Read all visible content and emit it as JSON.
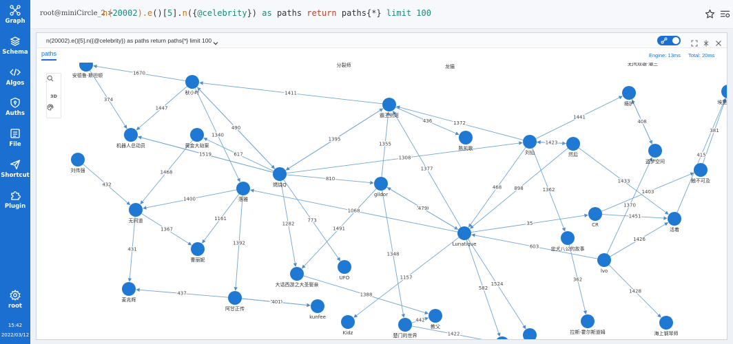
{
  "sidebar": {
    "items": [
      {
        "label": "Graph",
        "icon": "graph-icon"
      },
      {
        "label": "Schema",
        "icon": "layers-icon"
      },
      {
        "label": "Algos",
        "icon": "code-icon"
      },
      {
        "label": "Auths",
        "icon": "shield-icon"
      },
      {
        "label": "File",
        "icon": "file-icon"
      },
      {
        "label": "Shortcut",
        "icon": "send-icon"
      },
      {
        "label": "Plugin",
        "icon": "puzzle-icon"
      }
    ],
    "user": "root",
    "time": "15:42",
    "date": "2022/03/12"
  },
  "command": {
    "prompt": "root@miniCircle_2 >",
    "query_parts": [
      {
        "t": "n(",
        "c": "q-fn"
      },
      {
        "t": "20002",
        "c": "q-num"
      },
      {
        "t": ").",
        "c": "q-fn"
      },
      {
        "t": "e",
        "c": "q-fn"
      },
      {
        "t": "()[",
        "c": "q-txt"
      },
      {
        "t": "5",
        "c": "q-num"
      },
      {
        "t": "].",
        "c": "q-txt"
      },
      {
        "t": "n",
        "c": "q-fn"
      },
      {
        "t": "({",
        "c": "q-txt"
      },
      {
        "t": "@celebrity",
        "c": "q-num"
      },
      {
        "t": "}) ",
        "c": "q-txt"
      },
      {
        "t": "as",
        "c": "q-num"
      },
      {
        "t": " paths ",
        "c": "q-txt"
      },
      {
        "t": "return",
        "c": "q-kw"
      },
      {
        "t": " paths",
        "c": "q-txt"
      },
      {
        "t": "{*} ",
        "c": "q-txt"
      },
      {
        "t": "limit",
        "c": "q-num"
      },
      {
        "t": " 100",
        "c": "q-num"
      }
    ]
  },
  "panel": {
    "title": "n(20002).e()[5].n({@celebrity}) as paths return paths{*} limit 100",
    "tab": "paths",
    "engine": "Engine: 13ms",
    "total": "Total: 20ms"
  },
  "toolbox": {
    "search": "search-icon",
    "mode_3d": "3D",
    "style": "palette-icon"
  },
  "graph": {
    "node_color": "#1f78d1",
    "edge_color": "#6fa4d8",
    "nodes": [
      {
        "id": "n1",
        "label": "安德鲁·斯坦顿"
      },
      {
        "id": "n2",
        "label": "秋小叶"
      },
      {
        "id": "n3",
        "label": "机器人总动员"
      },
      {
        "id": "n4",
        "label": "黄金大劫案"
      },
      {
        "id": "n5",
        "label": "刘伟强"
      },
      {
        "id": "n6",
        "label": "燃烧Q"
      },
      {
        "id": "n7",
        "label": "落雅"
      },
      {
        "id": "n8",
        "label": "无间道"
      },
      {
        "id": "n9",
        "label": "霸王别姬"
      },
      {
        "id": "n10",
        "label": "陈凯歌"
      },
      {
        "id": "n11",
        "label": "gildor"
      },
      {
        "id": "n12",
        "label": "刘仙"
      },
      {
        "id": "n13",
        "label": "然后"
      },
      {
        "id": "n14",
        "label": "瘾护"
      },
      {
        "id": "n15",
        "label": "盗梦空间"
      },
      {
        "id": "n16",
        "label": "触不可及"
      },
      {
        "id": "n17",
        "label": "Lunatique"
      },
      {
        "id": "n18",
        "label": "CR"
      },
      {
        "id": "n19",
        "label": "活着"
      },
      {
        "id": "n20",
        "label": "忠犬八公的故事"
      },
      {
        "id": "n21",
        "label": "lvo"
      },
      {
        "id": "n22",
        "label": "曹丽妮"
      },
      {
        "id": "n23",
        "label": "麦兆辉"
      },
      {
        "id": "n24",
        "label": "大话西游之大圣娶亲"
      },
      {
        "id": "n25",
        "label": "UFO"
      },
      {
        "id": "n26",
        "label": "阿甘正传"
      },
      {
        "id": "n27",
        "label": "kunfee"
      },
      {
        "id": "n28",
        "label": "Kidz"
      },
      {
        "id": "n29",
        "label": "楚门的世界"
      },
      {
        "id": "n30",
        "label": "教父"
      },
      {
        "id": "n31",
        "label": "拉斯·霍尔斯道姆"
      },
      {
        "id": "n32",
        "label": "海上钢琴师"
      },
      {
        "id": "n33",
        "label": "埃里克·"
      },
      {
        "id": "n34",
        "label": ""
      },
      {
        "id": "n35",
        "label": ""
      }
    ],
    "partial_labels": [
      "分裂师",
      "龙猫",
      "无间双雄·潮三"
    ],
    "edges": [
      {
        "from": "n1",
        "to": "n3",
        "label": "374"
      },
      {
        "from": "n2",
        "to": "n3",
        "label": "1447"
      },
      {
        "from": "n2",
        "to": "n7",
        "label": "1340"
      },
      {
        "from": "n6",
        "to": "n3",
        "label": "1439"
      },
      {
        "from": "n6",
        "to": "n4",
        "label": "617"
      },
      {
        "from": "n6",
        "to": "n2",
        "label": "639"
      },
      {
        "from": "n6",
        "to": "n9",
        "label": "1382"
      },
      {
        "from": "n6",
        "to": "n11",
        "label": "810"
      },
      {
        "from": "n5",
        "to": "n8",
        "label": "432"
      },
      {
        "from": "n7",
        "to": "n8",
        "label": "1400"
      },
      {
        "from": "n4",
        "to": "n8",
        "label": "1468"
      },
      {
        "from": "n8",
        "to": "n22",
        "label": "1367"
      },
      {
        "from": "n7",
        "to": "n22",
        "label": "1161"
      },
      {
        "from": "n7",
        "to": "n26",
        "label": "1392"
      },
      {
        "from": "n8",
        "to": "n23",
        "label": "431"
      },
      {
        "from": "n17",
        "to": "n7",
        "label": "1068"
      },
      {
        "from": "n11",
        "to": "n17",
        "label": "1010"
      },
      {
        "from": "n17",
        "to": "n11",
        "label": "479"
      },
      {
        "from": "n9",
        "to": "n10",
        "label": "436"
      },
      {
        "from": "n11",
        "to": "n9",
        "label": "1355"
      },
      {
        "from": "n17",
        "to": "n9",
        "label": "1377"
      },
      {
        "from": "n12",
        "to": "n17",
        "label": "468"
      },
      {
        "from": "n13",
        "to": "n17",
        "label": "898"
      },
      {
        "from": "n12",
        "to": "n14",
        "label": "1441"
      },
      {
        "from": "n14",
        "to": "n15",
        "label": "375"
      },
      {
        "from": "n13",
        "to": "n19",
        "label": "1433"
      },
      {
        "from": "n18",
        "to": "n16",
        "label": "1403"
      },
      {
        "from": "n17",
        "to": "n18",
        "label": "35"
      },
      {
        "from": "n18",
        "to": "n19",
        "label": "1451"
      },
      {
        "from": "n21",
        "to": "n17",
        "label": "603"
      },
      {
        "from": "n21",
        "to": "n19",
        "label": "1426"
      },
      {
        "from": "n21",
        "to": "n15",
        "label": "1370"
      },
      {
        "from": "n21",
        "to": "n32",
        "label": "1428"
      },
      {
        "from": "n12",
        "to": "n20",
        "label": "1362"
      },
      {
        "from": "n20",
        "to": "n31",
        "label": "362"
      },
      {
        "from": "n6",
        "to": "n24",
        "label": "1282"
      },
      {
        "from": "n6",
        "to": "n25",
        "label": "773"
      },
      {
        "from": "n11",
        "to": "n24",
        "label": "1491"
      },
      {
        "from": "n11",
        "to": "n29",
        "label": "1348"
      },
      {
        "from": "n17",
        "to": "n28",
        "label": "1157"
      },
      {
        "from": "n24",
        "to": "n30",
        "label": "1388"
      },
      {
        "from": "n17",
        "to": "n34",
        "label": "582"
      },
      {
        "from": "n17",
        "to": "n35",
        "label": "1524"
      },
      {
        "from": "n26",
        "to": "n27",
        "label": "1440"
      },
      {
        "from": "n6",
        "to": "n12",
        "label": "1308"
      },
      {
        "from": "n12",
        "to": "n9",
        "label": "1372"
      },
      {
        "from": "n13",
        "to": "n12",
        "label": "1339"
      },
      {
        "from": "n12",
        "to": "n13",
        "label": "1492"
      },
      {
        "from": "n13",
        "to": "n12",
        "label": "1423"
      },
      {
        "from": "n9",
        "to": "n6",
        "label": "1395"
      },
      {
        "from": "n9",
        "to": "n2",
        "label": "1411"
      },
      {
        "from": "n2",
        "to": "n6",
        "label": "490"
      },
      {
        "from": "n2",
        "to": "n1",
        "label": "1670"
      },
      {
        "from": "n6",
        "to": "n3",
        "label": "51"
      },
      {
        "from": "n26",
        "to": "n23",
        "label": "437"
      },
      {
        "from": "n26",
        "to": "n27",
        "label": "401"
      },
      {
        "from": "n29",
        "to": "n30",
        "label": "442"
      },
      {
        "from": "n29",
        "to": "n34",
        "label": "1422"
      },
      {
        "from": "n16",
        "to": "n33",
        "label": "381"
      },
      {
        "from": "n19",
        "to": "n33",
        "label": "415"
      },
      {
        "from": "n15",
        "to": "n14",
        "label": "408"
      }
    ]
  }
}
